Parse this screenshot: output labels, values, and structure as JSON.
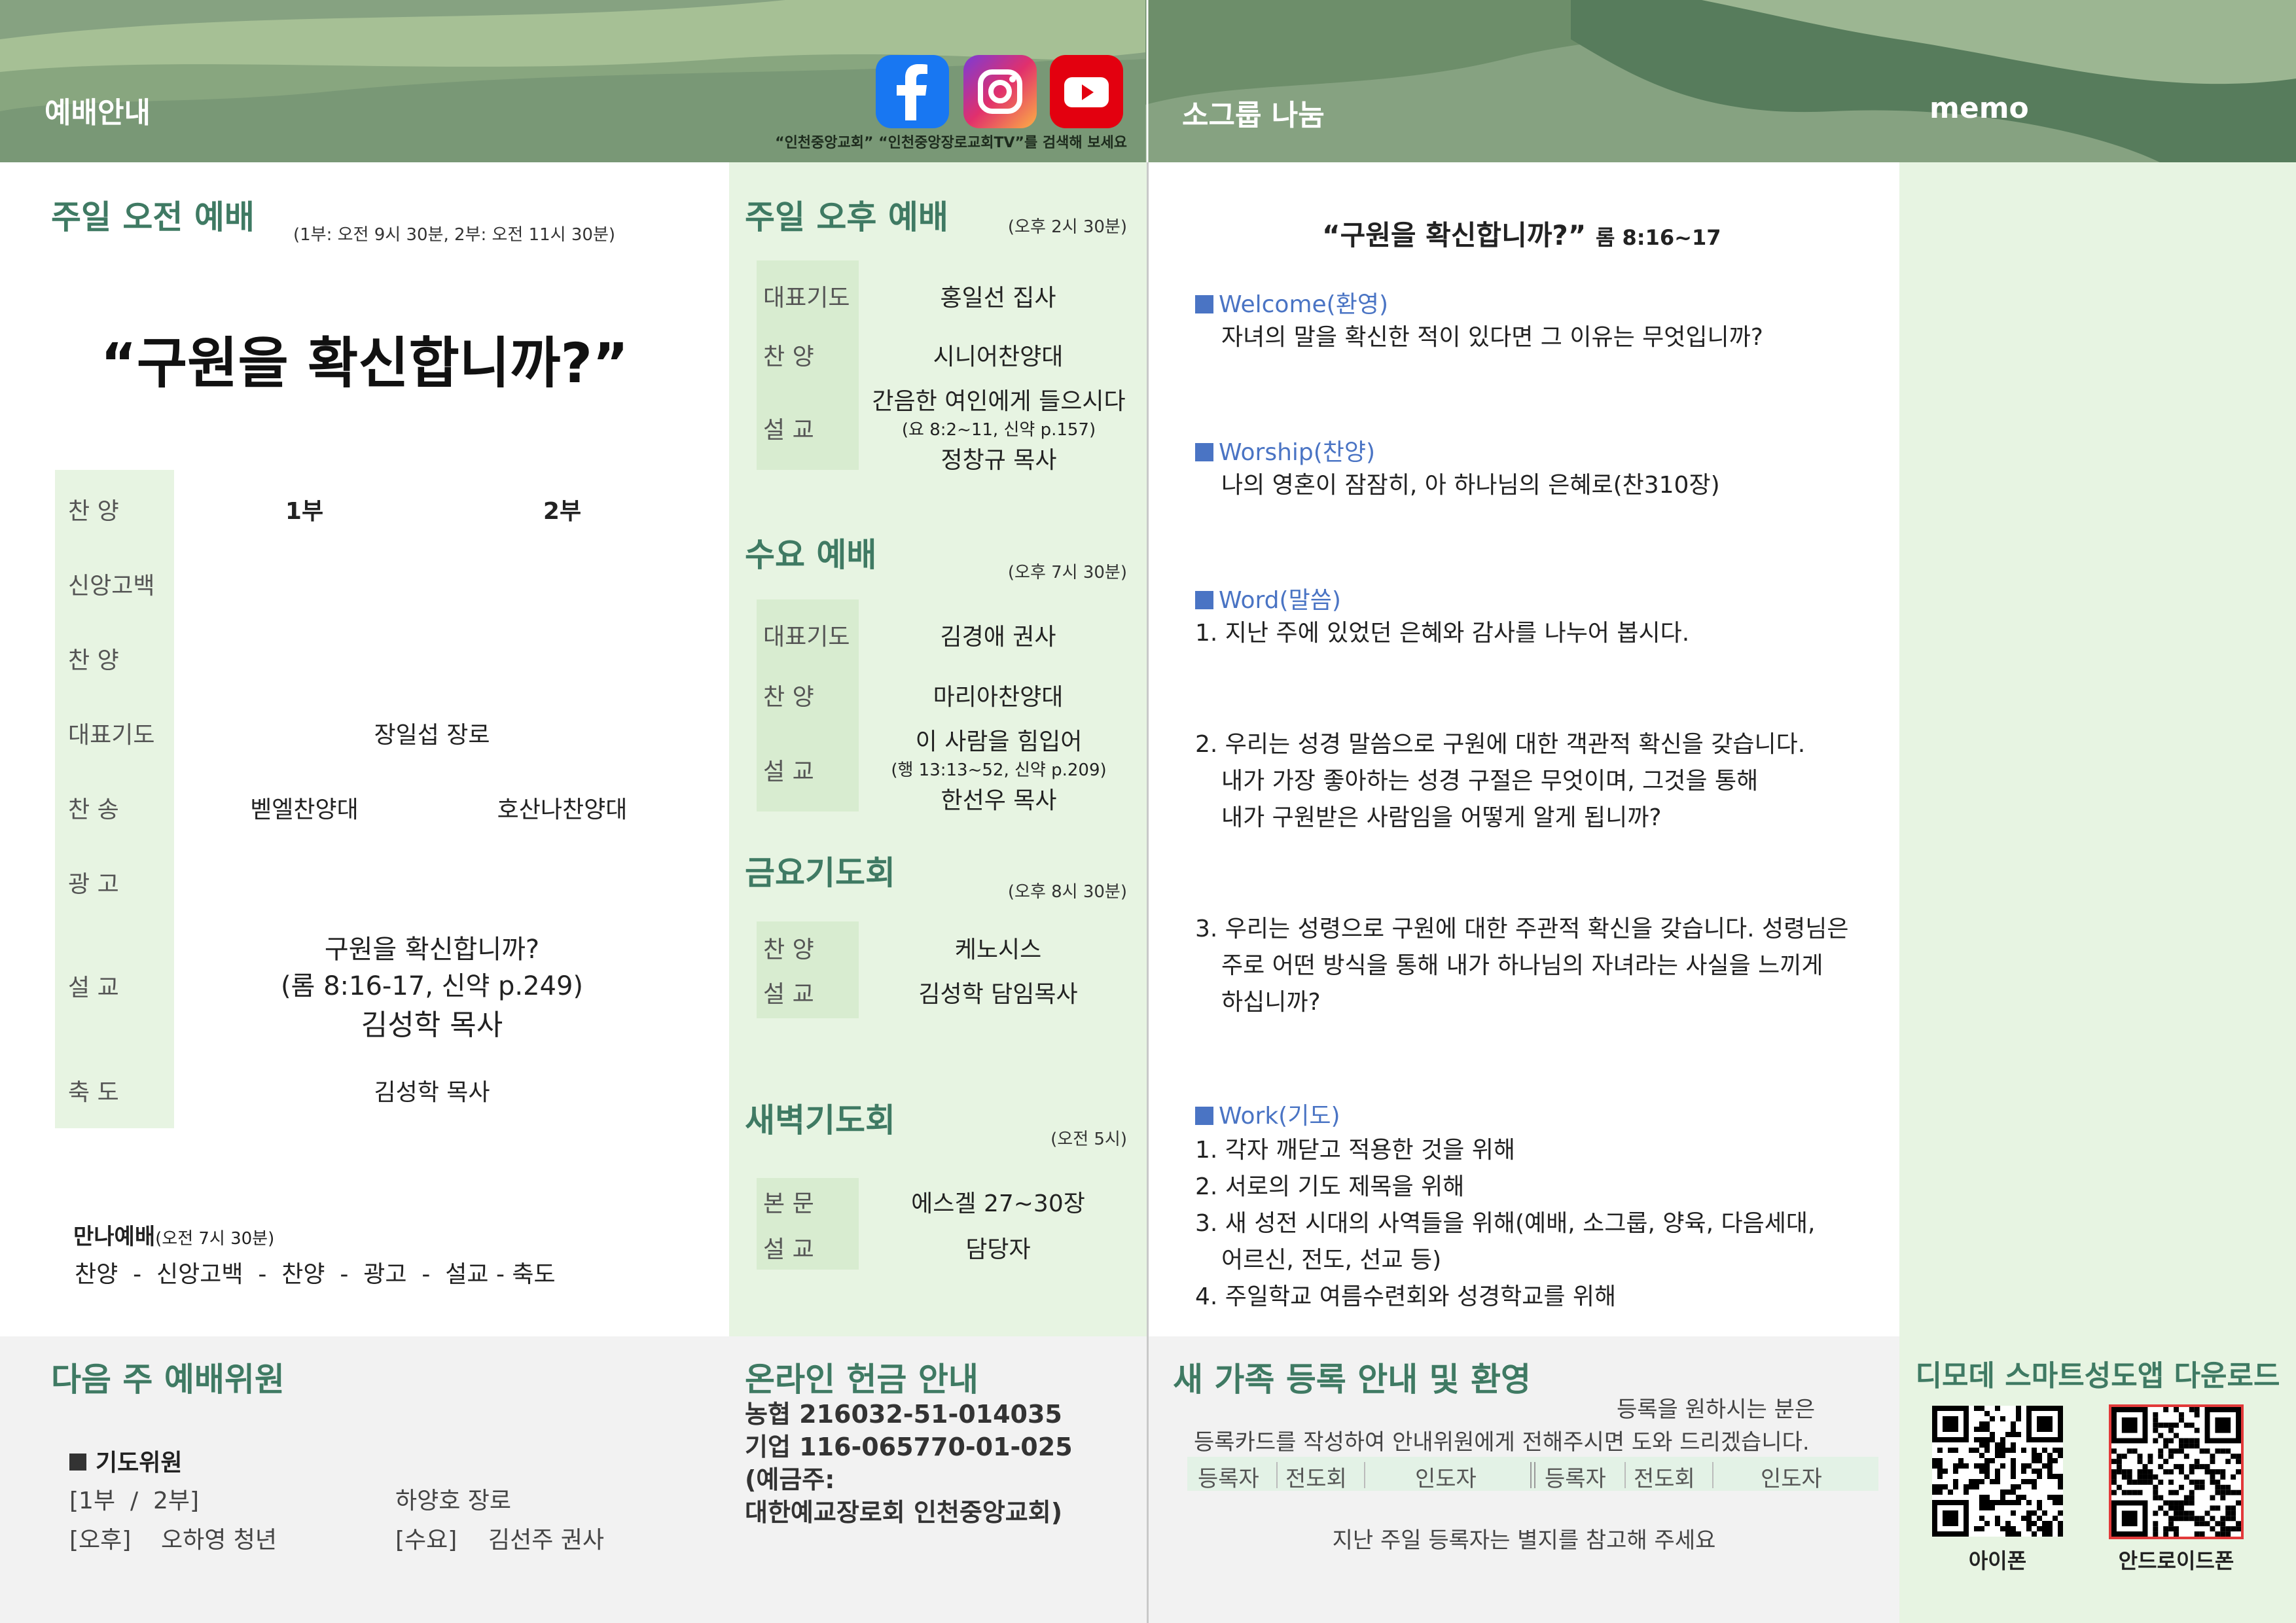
{
  "header": {
    "left_title": "예배안내",
    "mid_title": "소그룹 나눔",
    "memo_title": "memo",
    "search_note": "“인천중앙교회” “인천중앙장로교회TV”를 검색해 보세요",
    "icons": [
      "facebook-icon",
      "instagram-icon",
      "youtube-icon"
    ]
  },
  "sunday_am": {
    "title": "주일 오전 예배",
    "time": "(1부: 오전 9시 30분, 2부: 오전 11시 30분)",
    "sermon_title": "“구원을  확신합니까?”",
    "col1": "1부",
    "col2": "2부",
    "rows": [
      {
        "label": "찬      양",
        "v1": "",
        "v2": ""
      },
      {
        "label": "신앙고백",
        "v1": "",
        "v2": ""
      },
      {
        "label": "찬      양",
        "v1": "",
        "v2": ""
      },
      {
        "label": "대표기도",
        "both": "장일섭 장로"
      },
      {
        "label": "찬      송",
        "v1": "벧엘찬양대",
        "v2": "호산나찬양대"
      },
      {
        "label": "광      고",
        "v1": "",
        "v2": ""
      },
      {
        "label": "설      교",
        "line1": "구원을  확신합니까?",
        "line2": "(롬 8:16-17, 신약 p.249)",
        "line3": "김성학 목사"
      },
      {
        "label": "축      도",
        "both": "김성학 목사"
      }
    ],
    "manna_title": "만나예배",
    "manna_time": "(오전 7시 30분)",
    "manna_order": "찬양  -  신앙고백  -  찬양  -  광고  -  설교 - 축도"
  },
  "sunday_pm": {
    "title": "주일 오후 예배",
    "time": "(오후 2시 30분)",
    "rows": [
      {
        "label": "대표기도",
        "value": "홍일선 집사"
      },
      {
        "label": "찬      양",
        "value": "시니어찬양대"
      },
      {
        "label": "설      교",
        "value": "간음한 여인에게 들으시다",
        "ref": "(요 8:2~11, 신약 p.157)",
        "preacher": "정창규 목사"
      }
    ]
  },
  "wednesday": {
    "title": "수요 예배",
    "time": "(오후 7시 30분)",
    "rows": [
      {
        "label": "대표기도",
        "value": "김경애 권사"
      },
      {
        "label": "찬      양",
        "value": "마리아찬양대"
      },
      {
        "label": "설      교",
        "value": "이 사람을 힘입어",
        "ref": "(행 13:13~52, 신약 p.209)",
        "preacher": "한선우 목사"
      }
    ]
  },
  "friday": {
    "title": "금요기도회",
    "time": "(오후 8시 30분)",
    "rows": [
      {
        "label": "찬      양",
        "value": "케노시스"
      },
      {
        "label": "설      교",
        "value": "김성학 담임목사"
      }
    ]
  },
  "dawn": {
    "title": "새벽기도회",
    "time": "(오전 5시)",
    "rows": [
      {
        "label": "본      문",
        "value": "에스겔 27~30장"
      },
      {
        "label": "설      교",
        "value": "담당자"
      }
    ]
  },
  "small_group": {
    "title": "“구원을 확신합니까?”",
    "ref": "롬 8:16~17",
    "welcome_head": "Welcome(환영)",
    "welcome_q": "자녀의 말을 확신한 적이 있다면 그 이유는 무엇입니까?",
    "worship_head": "Worship(찬양)",
    "worship_text": "나의 영혼이 잠잠히, 아 하나님의 은혜로(찬310장)",
    "word_head": "Word(말씀)",
    "word_q1": "1. 지난 주에 있었던 은혜와 감사를 나누어 봅시다.",
    "word_q2a": "2. 우리는 성경 말씀으로 구원에 대한 객관적 확신을 갖습니다.",
    "word_q2b": "내가 가장 좋아하는 성경 구절은 무엇이며, 그것을 통해",
    "word_q2c": "내가 구원받은 사람임을 어떻게 알게 됩니까?",
    "word_q3a": "3. 우리는 성령으로 구원에 대한 주관적 확신을 갖습니다. 성령님은",
    "word_q3b": "주로 어떤 방식을 통해 내가 하나님의 자녀라는 사실을 느끼게",
    "word_q3c": "하십니까?",
    "work_head": "Work(기도)",
    "work_1": "1. 각자 깨닫고 적용한 것을 위해",
    "work_2": "2. 서로의 기도 제목을 위해",
    "work_3a": "3. 새 성전 시대의 사역들을 위해(예배, 소그룹, 양육, 다음세대,",
    "work_3b": "어르신, 전도, 선교 등)",
    "work_4": "4. 주일학교 여름수련회와 성경학교를 위해"
  },
  "next_week": {
    "title": "다음 주 예배위원",
    "prayer_head": "기도위원",
    "r1_label": "[1부  /  2부]",
    "r1_value": "하양호 장로",
    "r2_label": "[오후]",
    "r2_value": "오하영 청년",
    "r3_label": "[수요]",
    "r3_value": "김선주 권사"
  },
  "offering": {
    "title": "온라인 헌금 안내",
    "l1": "농협  216032-51-014035",
    "l2": "기업  116-065770-01-025",
    "l3": "(예금주:",
    "l4": "대한예교장로회 인천중앙교회)"
  },
  "newfamily": {
    "title": "새 가족 등록 안내 및 환영",
    "note1": "등록을 원하시는 분은",
    "note2": "등록카드를 작성하여 안내위원에게 전해주시면 도와 드리겠습니다.",
    "cols": [
      "등록자",
      "전도회",
      "인도자",
      "등록자",
      "전도회",
      "인도자"
    ],
    "footer": "지난 주일 등록자는 별지를 참고해 주세요"
  },
  "app": {
    "title": "디모데 스마트성도앱 다운로드",
    "iphone": "아이폰",
    "android": "안드로이드폰"
  }
}
